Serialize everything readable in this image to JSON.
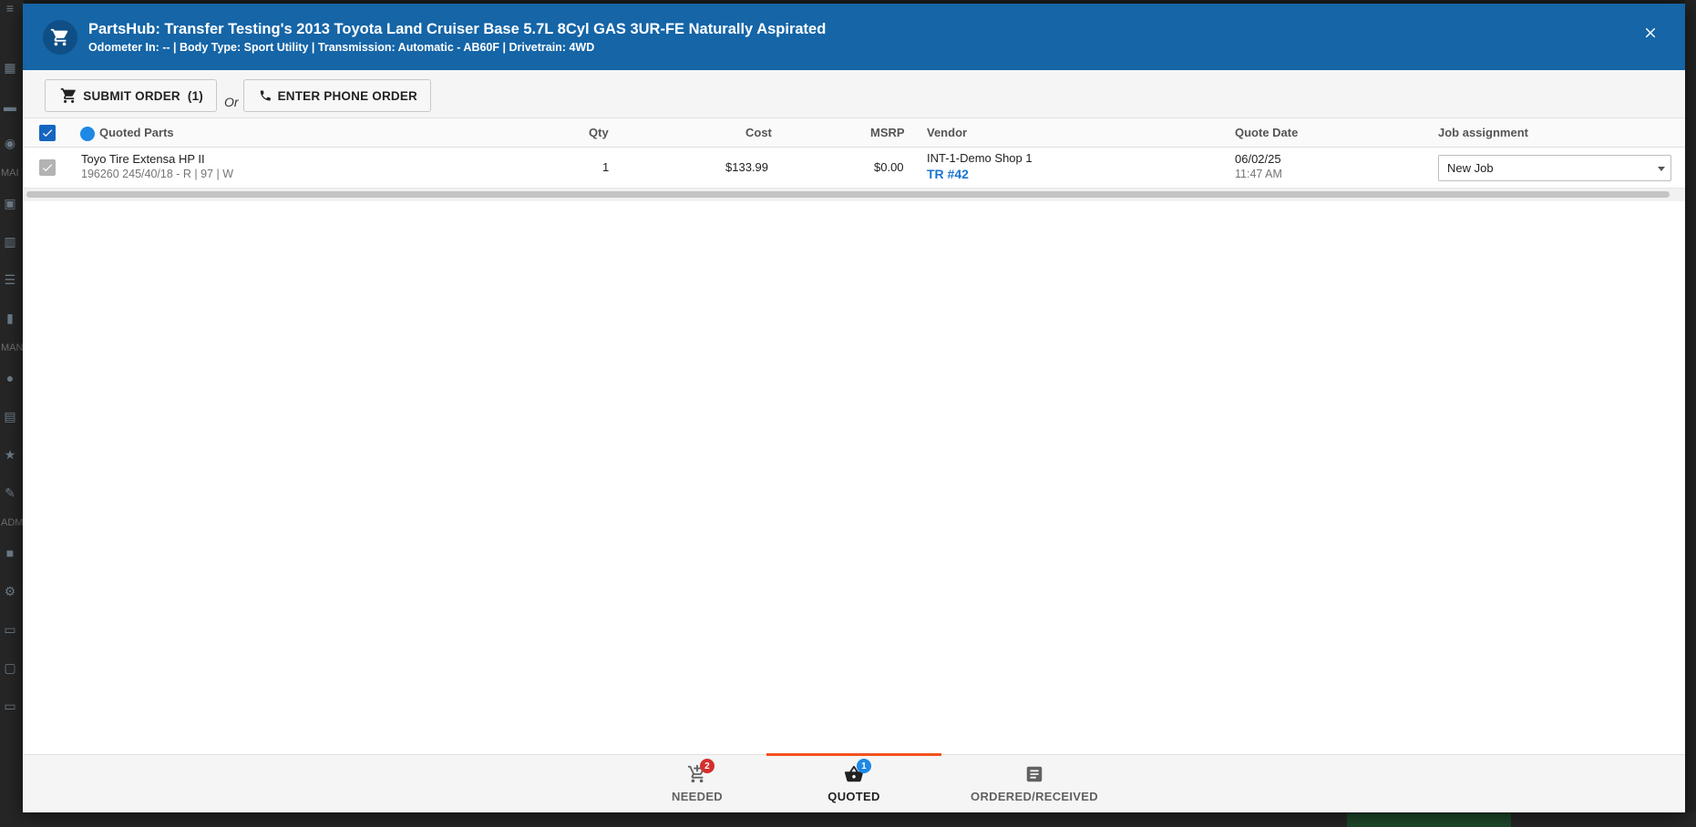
{
  "header": {
    "title": "PartsHub: Transfer Testing's 2013 Toyota Land Cruiser Base 5.7L 8Cyl GAS 3UR-FE Naturally Aspirated",
    "subtitle": "Odometer In: -- | Body Type:  Sport Utility | Transmission: Automatic - AB60F | Drivetrain: 4WD",
    "icon": "shopping-cart-icon",
    "close_icon": "close-icon",
    "color": "#1565a7"
  },
  "toolbar": {
    "submit_label": "SUBMIT ORDER",
    "submit_count": "(1)",
    "or_label": "Or",
    "phone_label": "ENTER PHONE ORDER"
  },
  "table": {
    "columns": {
      "part": "Quoted Parts",
      "qty": "Qty",
      "cost": "Cost",
      "msrp": "MSRP",
      "vendor": "Vendor",
      "quote_date": "Quote Date",
      "job": "Job assignment"
    },
    "rows": [
      {
        "name": "Toyo Tire Extensa HP II",
        "detail": "196260 245/40/18 - R | 97 | W",
        "qty": "1",
        "cost": "$133.99",
        "msrp": "$0.00",
        "vendor": "INT-1-Demo Shop 1",
        "vendor_ref": "TR #42",
        "date": "06/02/25",
        "time": "11:47 AM",
        "job": "New Job"
      }
    ]
  },
  "footer": {
    "tabs": [
      {
        "label": "NEEDED",
        "badge": "2",
        "icon": "cart-plus-icon",
        "badge_color": "#d32f2f"
      },
      {
        "label": "QUOTED",
        "badge": "1",
        "icon": "basket-icon",
        "badge_color": "#1e88e5",
        "active": true
      },
      {
        "label": "ORDERED/RECEIVED",
        "icon": "list-icon"
      }
    ],
    "accent": "#f4511e"
  },
  "background": {
    "side_labels": [
      "MAI",
      "MAN",
      "ADM"
    ]
  }
}
